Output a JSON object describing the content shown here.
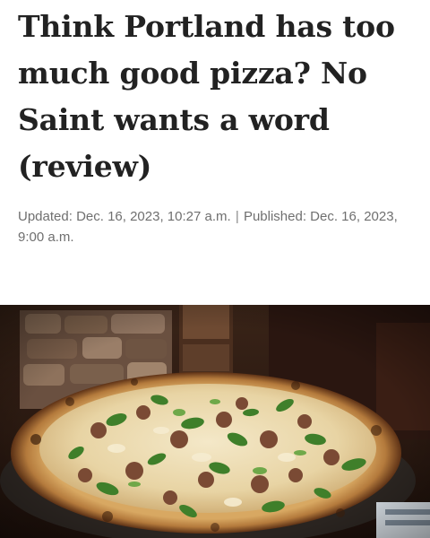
{
  "article": {
    "headline": "Think Portland has too much good pizza? No Saint wants a word (review)",
    "updated_label": "Updated:",
    "updated_value": "Dec. 16, 2023, 10:27 a.m.",
    "separator": "|",
    "published_label": "Published:",
    "published_value": "Dec. 16, 2023, 9:00 a.m."
  },
  "photo": {
    "subject": "pizza-photo"
  }
}
